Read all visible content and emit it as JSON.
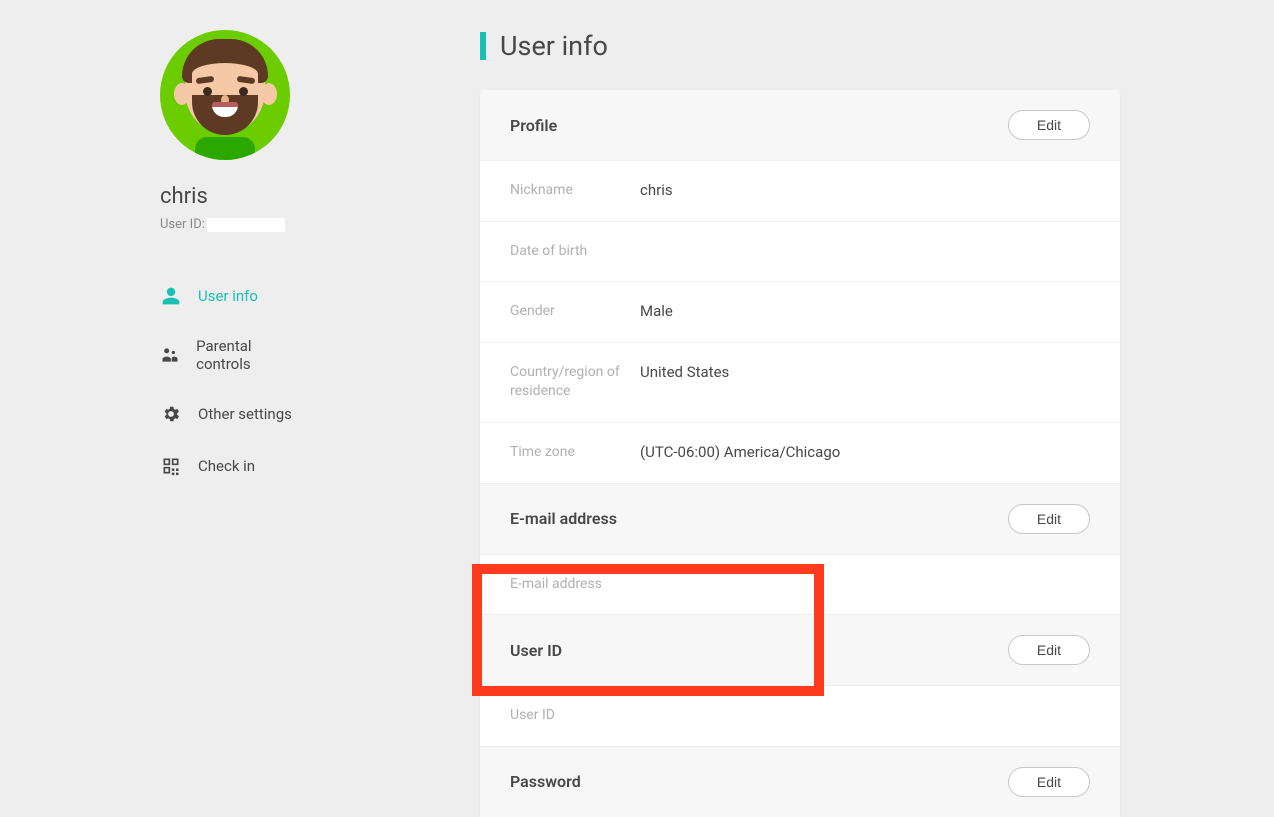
{
  "sidebar": {
    "username": "chris",
    "userid_label": "User ID:",
    "nav": [
      {
        "label": "User info",
        "icon": "person-icon",
        "active": true
      },
      {
        "label": "Parental controls",
        "icon": "parental-icon",
        "active": false
      },
      {
        "label": "Other settings",
        "icon": "gear-icon",
        "active": false
      },
      {
        "label": "Check in",
        "icon": "qr-icon",
        "active": false
      }
    ]
  },
  "page": {
    "title": "User info",
    "edit_label": "Edit",
    "sections": {
      "profile": {
        "title": "Profile",
        "rows": {
          "nickname": {
            "label": "Nickname",
            "value": "chris"
          },
          "dob": {
            "label": "Date of birth",
            "value": ""
          },
          "gender": {
            "label": "Gender",
            "value": "Male"
          },
          "country": {
            "label": "Country/region of residence",
            "value": "United States"
          },
          "timezone": {
            "label": "Time zone",
            "value": "(UTC-06:00) America/Chicago"
          }
        }
      },
      "email": {
        "title": "E-mail address",
        "rows": {
          "email": {
            "label": "E-mail address",
            "value": ""
          }
        }
      },
      "userid": {
        "title": "User ID",
        "rows": {
          "userid": {
            "label": "User ID",
            "value": ""
          }
        }
      },
      "password": {
        "title": "Password"
      }
    }
  }
}
